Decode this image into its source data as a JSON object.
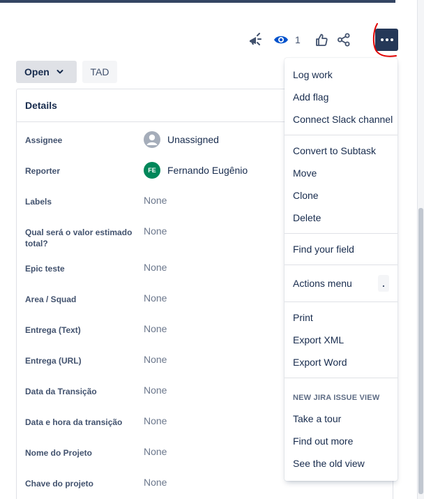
{
  "toolbar": {
    "watch_count": "1",
    "icons": [
      "feedback-megaphone-icon",
      "eye-icon",
      "thumbs-up-icon",
      "share-icon",
      "more-dots-icon"
    ]
  },
  "status": {
    "current": "Open",
    "tag": "TAD"
  },
  "details": {
    "title": "Details",
    "fields": [
      {
        "label": "Assignee",
        "value": "Unassigned"
      },
      {
        "label": "Reporter",
        "value": "Fernando Eugênio",
        "initials": "FE"
      },
      {
        "label": "Labels",
        "value": "None"
      },
      {
        "label": "Qual será o valor estimado total?",
        "value": "None"
      },
      {
        "label": "Epic teste",
        "value": "None"
      },
      {
        "label": "Area / Squad",
        "value": "None"
      },
      {
        "label": "Entrega (Text)",
        "value": "None"
      },
      {
        "label": "Entrega (URL)",
        "value": "None"
      },
      {
        "label": "Data da Transição",
        "value": "None"
      },
      {
        "label": "Data e hora da transição",
        "value": "None"
      },
      {
        "label": "Nome do Projeto",
        "value": "None"
      },
      {
        "label": "Chave do projeto",
        "value": "None"
      }
    ]
  },
  "menu": {
    "group1": [
      "Log work",
      "Add flag",
      "Connect Slack channel"
    ],
    "group2": [
      "Convert to Subtask",
      "Move",
      "Clone",
      "Delete"
    ],
    "group3": [
      "Find your field"
    ],
    "group4": {
      "label": "Actions menu",
      "shortcut": "."
    },
    "group5": [
      "Print",
      "Export XML",
      "Export Word"
    ],
    "group6_heading": "NEW JIRA ISSUE VIEW",
    "group6": [
      "Take a tour",
      "Find out more",
      "See the old view"
    ]
  },
  "colors": {
    "primary_dark": "#253858",
    "annotation_red": "#e00000",
    "reporter_avatar": "#00875a"
  }
}
